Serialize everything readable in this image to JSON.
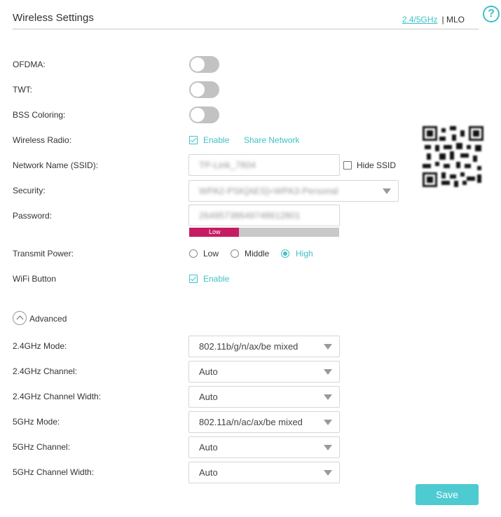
{
  "header": {
    "title": "Wireless Settings",
    "band_link": "2.4/5GHz",
    "band_sep": "| MLO",
    "help": "?"
  },
  "fields": {
    "ofdma_label": "OFDMA:",
    "twt_label": "TWT:",
    "bss_label": "BSS Coloring:",
    "radio_label": "Wireless Radio:",
    "radio_enable": "Enable",
    "share_network": "Share Network",
    "ssid_label": "Network Name (SSID):",
    "ssid_value": "TP-Link_7804",
    "hide_ssid": "Hide SSID",
    "security_label": "Security:",
    "security_value": "WPA2-PSK[AES]+WPA3-Personal",
    "password_label": "Password:",
    "password_value": "26495738649748612801",
    "strength_label": "Low",
    "strength_level": 0.33,
    "power_label": "Transmit Power:",
    "power_options": [
      "Low",
      "Middle",
      "High"
    ],
    "power_selected": "High",
    "wifi_btn_label": "WiFi Button",
    "wifi_btn_enable": "Enable"
  },
  "toggles": {
    "ofdma": false,
    "twt": false,
    "bss": false
  },
  "advanced": {
    "label": "Advanced",
    "rows": [
      {
        "label": "2.4GHz Mode:",
        "value": "802.11b/g/n/ax/be mixed"
      },
      {
        "label": "2.4GHz Channel:",
        "value": "Auto"
      },
      {
        "label": "2.4GHz Channel Width:",
        "value": "Auto"
      },
      {
        "label": "5GHz Mode:",
        "value": "802.11a/n/ac/ax/be mixed"
      },
      {
        "label": "5GHz Channel:",
        "value": "Auto"
      },
      {
        "label": "5GHz Channel Width:",
        "value": "Auto"
      }
    ]
  },
  "actions": {
    "save": "Save"
  },
  "colors": {
    "accent": "#3ec1c8",
    "strength_low": "#c61c62"
  }
}
